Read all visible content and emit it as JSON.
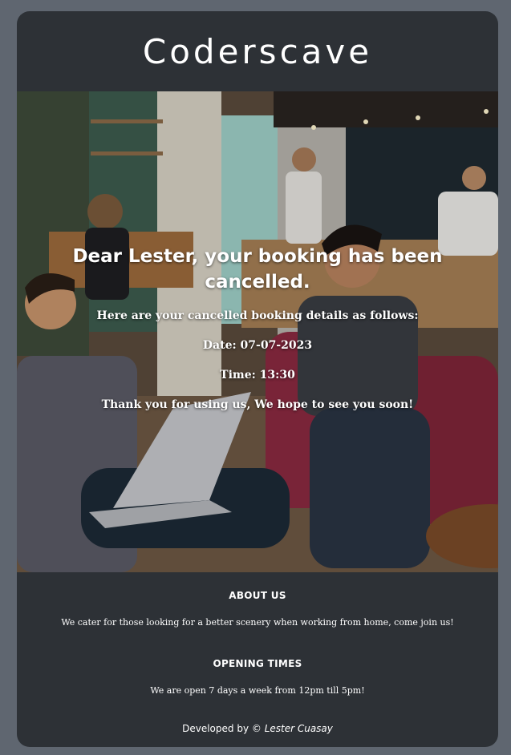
{
  "header": {
    "brand": "Coderscave"
  },
  "hero": {
    "title": "Dear Lester, your booking has been cancelled.",
    "intro": "Here are your cancelled booking details as follows:",
    "date": "Date: 07-07-2023",
    "time": "Time: 13:30",
    "closing": "Thank you for using us, We hope to see you soon!"
  },
  "footer": {
    "about_heading": "ABOUT US",
    "about_text": "We cater for those looking for a better scenery when working from home, come join us!",
    "hours_heading": "OPENING TIMES",
    "hours_text": "We are open 7 days a week from 12pm till 5pm!",
    "credit_prefix": "Developed by ©",
    "credit_author": "Lester Cuasay"
  },
  "colors": {
    "page_bg": "#5f6670",
    "card_bg": "#2d3136",
    "text": "#ffffff"
  }
}
